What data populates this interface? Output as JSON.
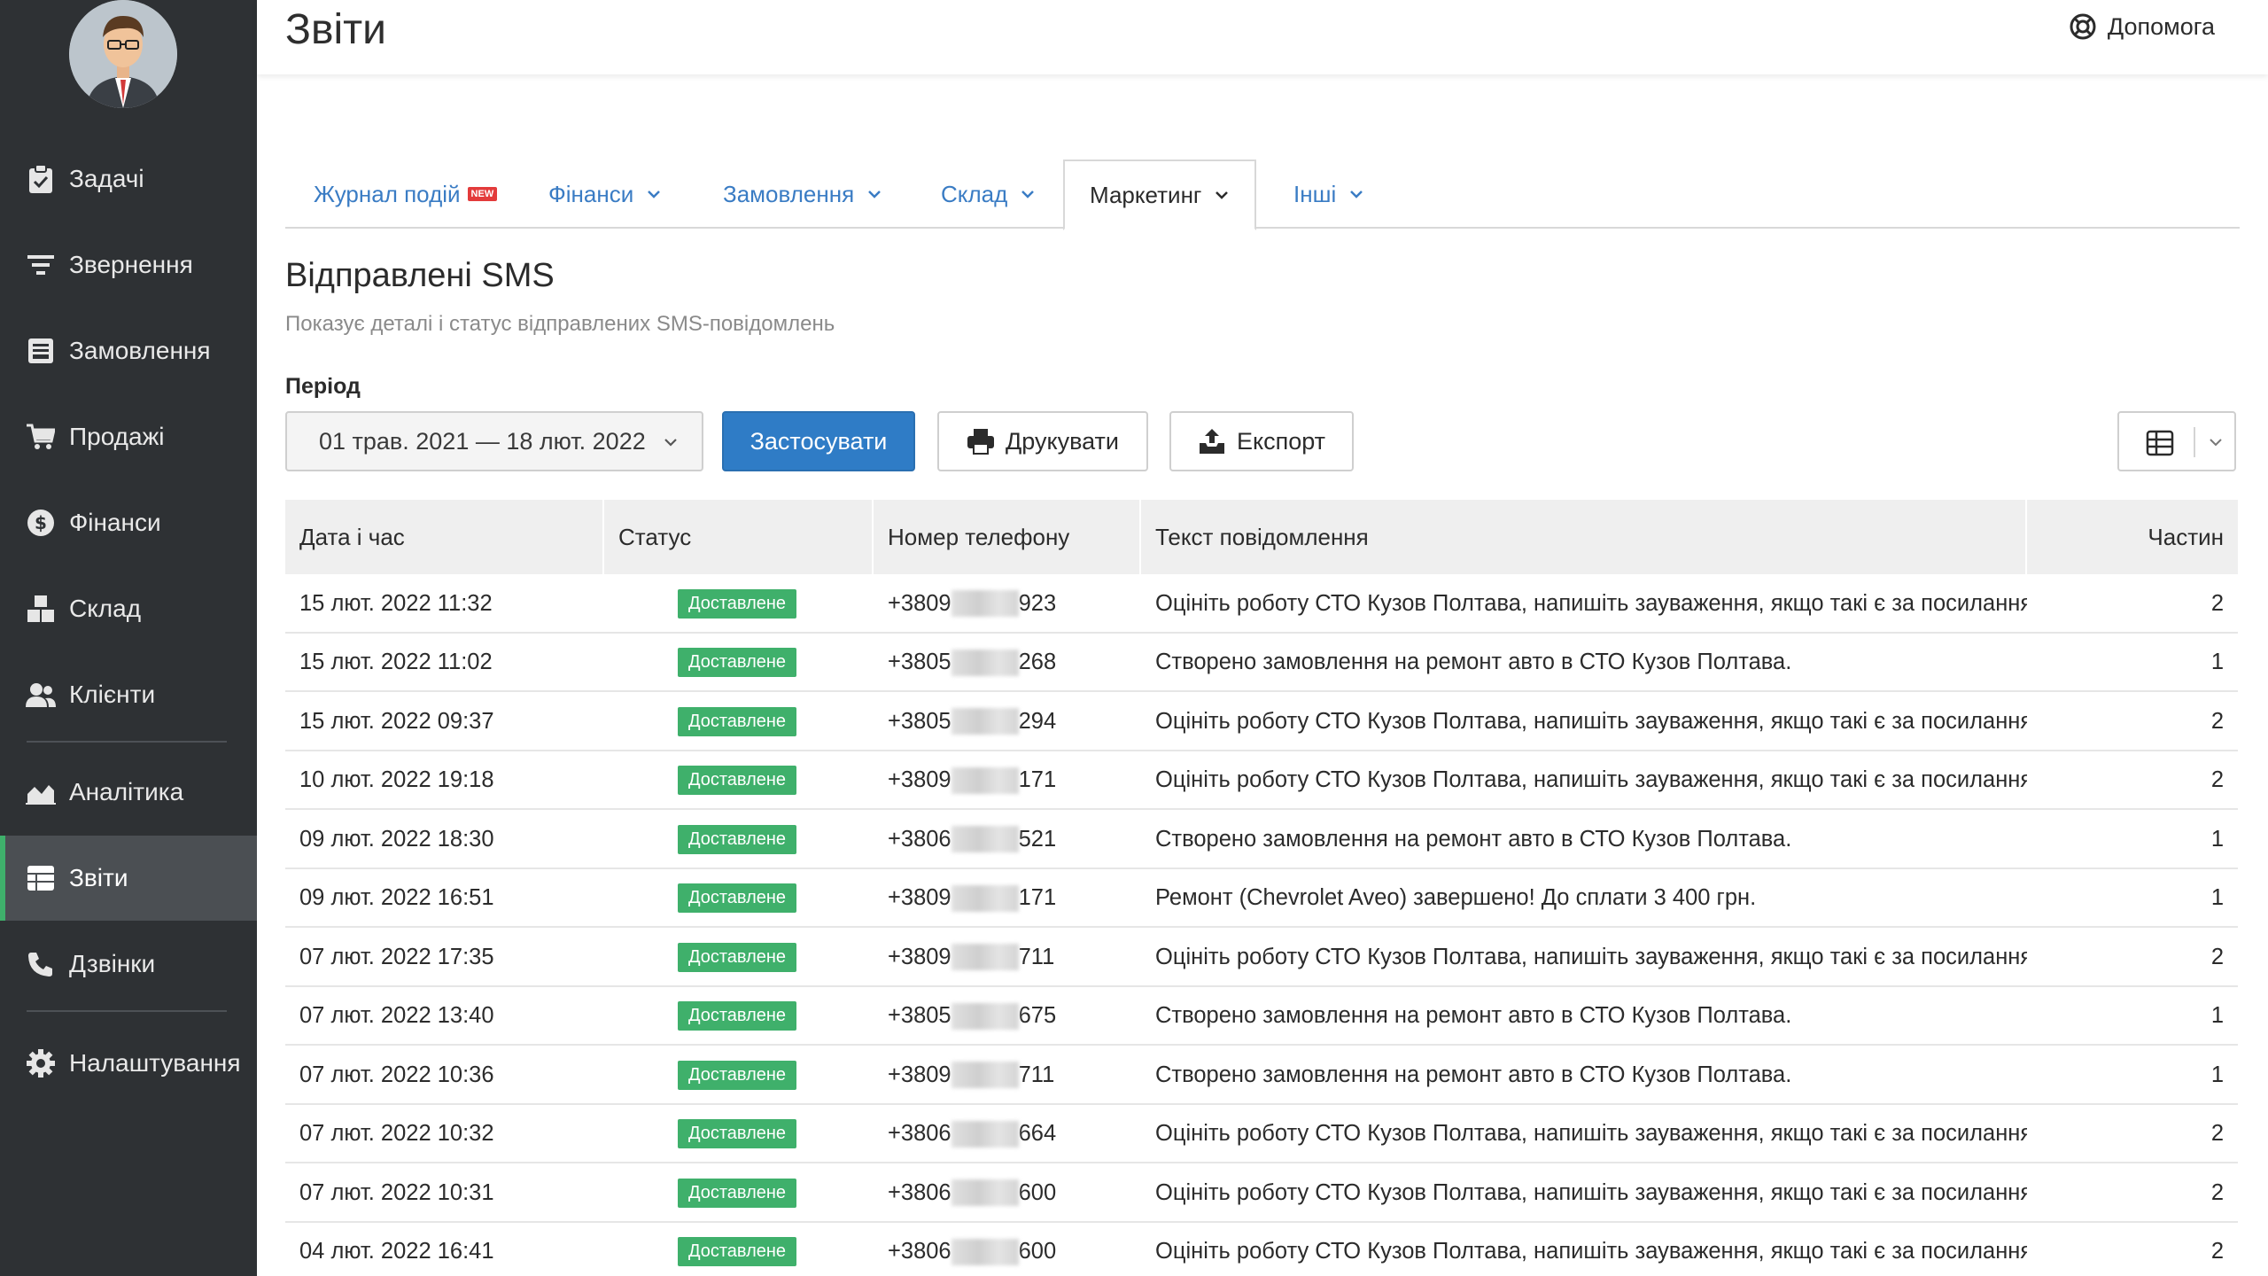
{
  "header": {
    "title": "Звіти",
    "help_label": "Допомога"
  },
  "sidebar": {
    "items": [
      {
        "label": "Задачі",
        "icon": "clipboard-check-icon"
      },
      {
        "label": "Звернення",
        "icon": "filter-icon"
      },
      {
        "label": "Замовлення",
        "icon": "inbox-icon"
      },
      {
        "label": "Продажі",
        "icon": "cart-icon"
      },
      {
        "label": "Фінанси",
        "icon": "dollar-circle-icon"
      },
      {
        "label": "Склад",
        "icon": "boxes-icon"
      },
      {
        "label": "Клієнти",
        "icon": "users-icon"
      },
      {
        "label": "Аналітика",
        "icon": "area-chart-icon"
      },
      {
        "label": "Звіти",
        "icon": "table-icon",
        "active": true
      },
      {
        "label": "Дзвінки",
        "icon": "phone-icon"
      },
      {
        "label": "Налаштування",
        "icon": "gear-icon"
      }
    ]
  },
  "tabs": [
    {
      "label": "Журнал подій",
      "badge": "NEW"
    },
    {
      "label": "Фінанси"
    },
    {
      "label": "Замовлення"
    },
    {
      "label": "Склад"
    },
    {
      "label": "Маркетинг",
      "active": true
    },
    {
      "label": "Інші"
    }
  ],
  "report": {
    "title": "Відправлені SMS",
    "subtitle": "Показує деталі і статус відправлених SMS-повідомлень",
    "period_label": "Період",
    "period_value": "01 трав. 2021 — 18 лют. 2022",
    "apply_label": "Застосувати",
    "print_label": "Друкувати",
    "export_label": "Експорт"
  },
  "table": {
    "columns": [
      "Дата і час",
      "Статус",
      "Номер телефону",
      "Текст повідомлення",
      "Частин"
    ],
    "rows": [
      {
        "date": "15 лют. 2022 11:32",
        "status": "Доставлене",
        "phone_prefix": "+3809",
        "phone_suffix": "923",
        "text": "Оцініть роботу СТО Кузов Полтава, напишіть зауваження, якщо такі є за посиланням: ...",
        "parts": "2"
      },
      {
        "date": "15 лют. 2022 11:02",
        "status": "Доставлене",
        "phone_prefix": "+3805",
        "phone_suffix": "268",
        "text": "Створено замовлення на ремонт авто в СТО Кузов Полтава.",
        "parts": "1"
      },
      {
        "date": "15 лют. 2022 09:37",
        "status": "Доставлене",
        "phone_prefix": "+3805",
        "phone_suffix": "294",
        "text": "Оцініть роботу СТО Кузов Полтава, напишіть зауваження, якщо такі є за посиланням: ...",
        "parts": "2"
      },
      {
        "date": "10 лют. 2022 19:18",
        "status": "Доставлене",
        "phone_prefix": "+3809",
        "phone_suffix": "171",
        "text": "Оцініть роботу СТО Кузов Полтава, напишіть зауваження, якщо такі є за посиланням: ...",
        "parts": "2"
      },
      {
        "date": "09 лют. 2022 18:30",
        "status": "Доставлене",
        "phone_prefix": "+3806",
        "phone_suffix": "521",
        "text": "Створено замовлення на ремонт авто в СТО Кузов Полтава.",
        "parts": "1"
      },
      {
        "date": "09 лют. 2022 16:51",
        "status": "Доставлене",
        "phone_prefix": "+3809",
        "phone_suffix": "171",
        "text": "Ремонт (Chevrolet Aveo) завершено! До сплати 3 400 грн.",
        "parts": "1"
      },
      {
        "date": "07 лют. 2022 17:35",
        "status": "Доставлене",
        "phone_prefix": "+3809",
        "phone_suffix": "711",
        "text": "Оцініть роботу СТО Кузов Полтава, напишіть зауваження, якщо такі є за посиланням: ...",
        "parts": "2"
      },
      {
        "date": "07 лют. 2022 13:40",
        "status": "Доставлене",
        "phone_prefix": "+3805",
        "phone_suffix": "675",
        "text": "Створено замовлення на ремонт авто в СТО Кузов Полтава.",
        "parts": "1"
      },
      {
        "date": "07 лют. 2022 10:36",
        "status": "Доставлене",
        "phone_prefix": "+3809",
        "phone_suffix": "711",
        "text": "Створено замовлення на ремонт авто в СТО Кузов Полтава.",
        "parts": "1"
      },
      {
        "date": "07 лют. 2022 10:32",
        "status": "Доставлене",
        "phone_prefix": "+3806",
        "phone_suffix": "664",
        "text": "Оцініть роботу СТО Кузов Полтава, напишіть зауваження, якщо такі є за посиланням:h...",
        "parts": "2"
      },
      {
        "date": "07 лют. 2022 10:31",
        "status": "Доставлене",
        "phone_prefix": "+3806",
        "phone_suffix": "600",
        "text": "Оцініть роботу СТО Кузов Полтава, напишіть зауваження, якщо такі є за посиланням:h...",
        "parts": "2"
      },
      {
        "date": "04 лют. 2022 16:41",
        "status": "Доставлене",
        "phone_prefix": "+3806",
        "phone_suffix": "600",
        "text": "Оцініть роботу СТО Кузов Полтава, напишіть зауваження, якщо такі є за посиланням:h...",
        "parts": "2"
      }
    ]
  },
  "colors": {
    "sidebar_bg": "#2e3134",
    "accent_green": "#3fb06b",
    "primary_blue": "#2f7cc6",
    "link_blue": "#3a7cc4"
  }
}
